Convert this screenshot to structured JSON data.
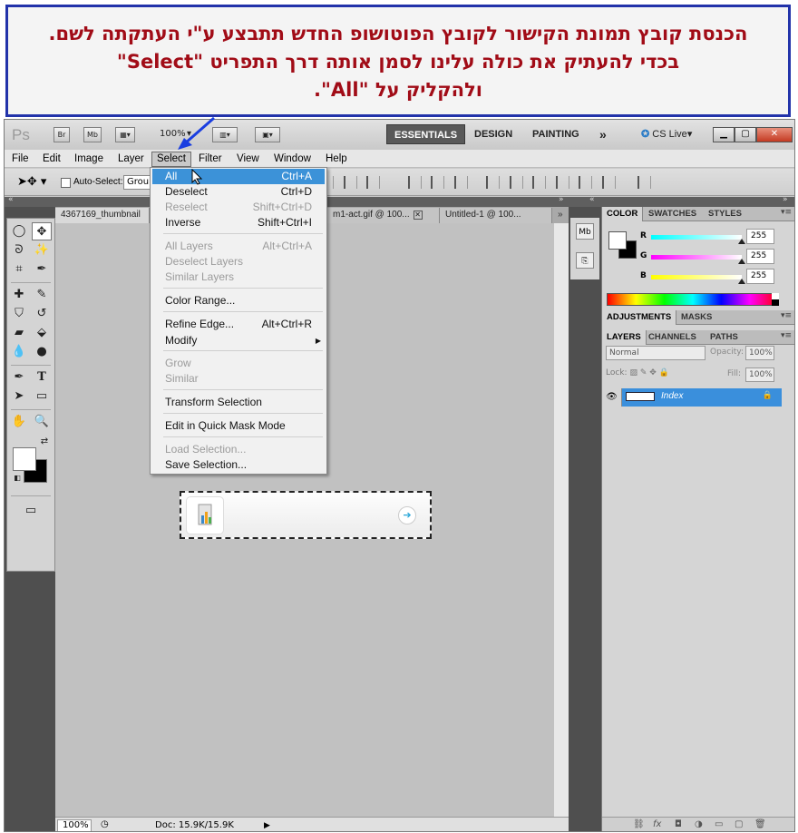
{
  "annotation": {
    "lines": [
      "הכנסת קובץ תמונת הקישור לקובץ הפוטושופ החדש תתבצע ע\"י העתקתה לשם.",
      "בכדי להעתיק את כולה עלינו לסמן אותה דרך התפריט \"Select\"",
      "ולהקליק על \"All\"."
    ],
    "color": "#a10c17",
    "border_color": "#2233aa"
  },
  "appbar": {
    "logo": "Ps",
    "br": "Br",
    "mb": "Mb",
    "zoom": "100%",
    "workspaces": [
      "ESSENTIALS",
      "DESIGN",
      "PAINTING"
    ],
    "more": "»",
    "cslive": "CS Live"
  },
  "menubar": {
    "items": [
      "File",
      "Edit",
      "Image",
      "Layer",
      "Select",
      "Filter",
      "View",
      "Window",
      "Help"
    ],
    "active": "Select"
  },
  "options": {
    "auto_select_label": "Auto-Select:",
    "auto_select_value": "Group"
  },
  "tabs": [
    {
      "label": "4367169_thumbnail"
    },
    {
      "label": "m1-act.gif @ 100..."
    },
    {
      "label": "Untitled-1 @ 100..."
    }
  ],
  "statusbar": {
    "zoom": "100%",
    "doc": "Doc: 15.9K/15.9K"
  },
  "select_menu": {
    "groups": [
      [
        {
          "label": "All",
          "shortcut": "Ctrl+A",
          "state": "highlight"
        },
        {
          "label": "Deselect",
          "shortcut": "Ctrl+D",
          "state": "enabled"
        },
        {
          "label": "Reselect",
          "shortcut": "Shift+Ctrl+D",
          "state": "disabled"
        },
        {
          "label": "Inverse",
          "shortcut": "Shift+Ctrl+I",
          "state": "enabled"
        }
      ],
      [
        {
          "label": "All Layers",
          "shortcut": "Alt+Ctrl+A",
          "state": "disabled"
        },
        {
          "label": "Deselect Layers",
          "shortcut": "",
          "state": "disabled"
        },
        {
          "label": "Similar Layers",
          "shortcut": "",
          "state": "disabled"
        }
      ],
      [
        {
          "label": "Color Range...",
          "shortcut": "",
          "state": "enabled"
        }
      ],
      [
        {
          "label": "Refine Edge...",
          "shortcut": "Alt+Ctrl+R",
          "state": "enabled"
        },
        {
          "label": "Modify",
          "shortcut": "",
          "state": "enabled",
          "submenu": true
        }
      ],
      [
        {
          "label": "Grow",
          "shortcut": "",
          "state": "disabled"
        },
        {
          "label": "Similar",
          "shortcut": "",
          "state": "disabled"
        }
      ],
      [
        {
          "label": "Transform Selection",
          "shortcut": "",
          "state": "enabled"
        }
      ],
      [
        {
          "label": "Edit in Quick Mask Mode",
          "shortcut": "",
          "state": "enabled"
        }
      ],
      [
        {
          "label": "Load Selection...",
          "shortcut": "",
          "state": "disabled"
        },
        {
          "label": "Save Selection...",
          "shortcut": "",
          "state": "enabled"
        }
      ]
    ]
  },
  "color_panel": {
    "tabs": [
      "COLOR",
      "SWATCHES",
      "STYLES"
    ],
    "r": "255",
    "g": "255",
    "b": "255",
    "r_label": "R",
    "g_label": "G",
    "b_label": "B"
  },
  "adjust_panel": {
    "tabs": [
      "ADJUSTMENTS",
      "MASKS"
    ]
  },
  "layers_panel": {
    "tabs": [
      "LAYERS",
      "CHANNELS",
      "PATHS"
    ],
    "blend_mode": "Normal",
    "opacity_label": "Opacity:",
    "opacity": "100%",
    "lock_label": "Lock:",
    "fill_label": "Fill:",
    "fill": "100%",
    "layer_name": "Index",
    "highlight_color": "#3a8fdc"
  },
  "icons": {
    "highlight": "#3c92d8"
  }
}
